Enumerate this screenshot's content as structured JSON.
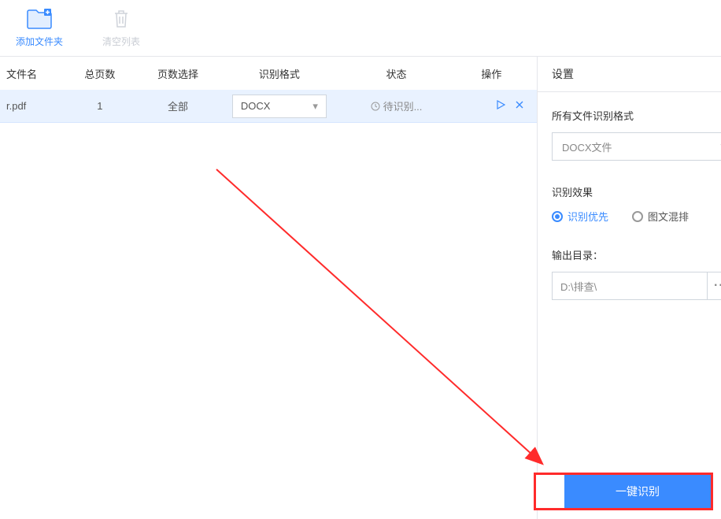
{
  "toolbar": {
    "add_folder_label": "添加文件夹",
    "clear_list_label": "清空列表"
  },
  "table": {
    "headers": {
      "name": "文件名",
      "pages": "总页数",
      "page_select": "页数选择",
      "format": "识别格式",
      "status": "状态",
      "action": "操作"
    },
    "rows": [
      {
        "name": "r.pdf",
        "pages": "1",
        "page_select": "全部",
        "format": "DOCX",
        "status": "待识别..."
      }
    ]
  },
  "settings": {
    "title": "设置",
    "format_label": "所有文件识别格式",
    "format_value": "DOCX文件",
    "effect_label": "识别效果",
    "effect_options": {
      "priority": "识别优先",
      "mixed": "图文混排"
    },
    "output_label": "输出目录：",
    "output_path": "D:\\排查\\",
    "output_browse": "···"
  },
  "bottom": {
    "start_label": "一键识别"
  }
}
